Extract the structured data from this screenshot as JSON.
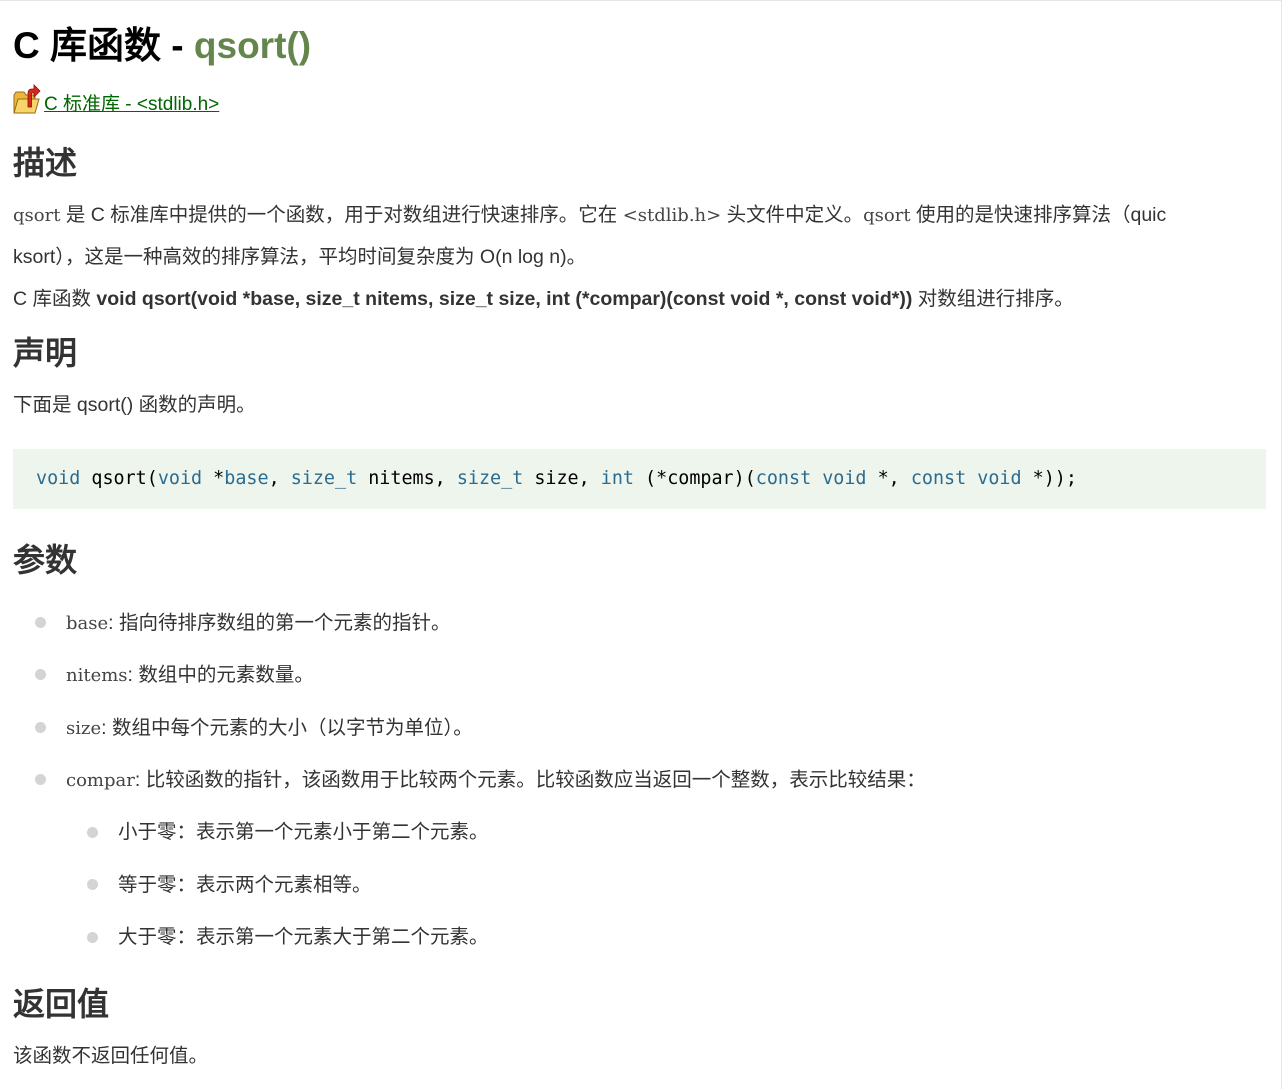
{
  "title": {
    "prefix": "C 库函数 - ",
    "function": "qsort()"
  },
  "breadcrumb": {
    "icon": "folder-up-icon",
    "link": "C 标准库 - <stdlib.h>"
  },
  "sections": {
    "description": {
      "heading": "描述",
      "line1_code1": "qsort",
      "line1_text1": " 是 C 标准库中提供的一个函数，用于对数组进行快速排序。它在 ",
      "line1_code2": "<stdlib.h>",
      "line1_text2": " 头文件中定义。",
      "line1_code3": "qsort",
      "line1_text3": " 使用的是快速排序算法（quic",
      "line2": "ksort），这是一种高效的排序算法，平均时间复杂度为 O(n log n)。",
      "line3_prefix": "C 库函数 ",
      "line3_signature": "void qsort(void *base, size_t nitems, size_t size, int (*compar)(const void *, const void*))",
      "line3_suffix": " 对数组进行排序。"
    },
    "declaration": {
      "heading": "声明",
      "intro": "下面是 qsort() 函数的声明。",
      "code": {
        "t1": "void",
        "t2": " qsort(",
        "t3": "void",
        "t4": " *",
        "t5": "base",
        "t6": ", ",
        "t7": "size_t",
        "t8": " nitems, ",
        "t9": "size_t",
        "t10": " size, ",
        "t11": "int",
        "t12": " (*compar)(",
        "t13": "const void",
        "t14": " *, ",
        "t15": "const void",
        "t16": " *));"
      }
    },
    "parameters": {
      "heading": "参数",
      "items": [
        {
          "name": "base",
          "desc": ": 指向待排序数组的第一个元素的指针。"
        },
        {
          "name": "nitems",
          "desc": ": 数组中的元素数量。"
        },
        {
          "name": "size",
          "desc": ": 数组中每个元素的大小（以字节为单位）。"
        },
        {
          "name": "compar",
          "desc": ": 比较函数的指针，该函数用于比较两个元素。比较函数应当返回一个整数，表示比较结果："
        }
      ],
      "subitems": [
        "小于零：表示第一个元素小于第二个元素。",
        "等于零：表示两个元素相等。",
        "大于零：表示第一个元素大于第二个元素。"
      ]
    },
    "return_value": {
      "heading": "返回值",
      "text": "该函数不返回任何值。"
    }
  }
}
